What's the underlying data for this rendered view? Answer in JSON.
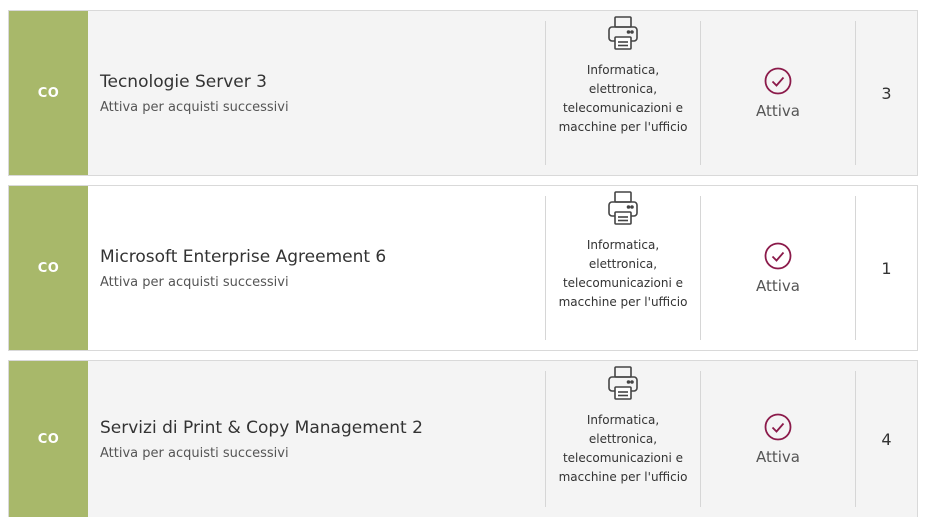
{
  "colors": {
    "type_strip": "#a8b86a",
    "status_icon": "#8b1a4a"
  },
  "rows": [
    {
      "type": "CO",
      "title": "Tecnologie Server 3",
      "subtitle": "Attiva per acquisti successivi",
      "category_icon": "printer-icon",
      "category": "Informatica, elettronica, telecomunicazioni e macchine per l'ufficio",
      "status_icon": "check-circle-icon",
      "status": "Attiva",
      "count": "3"
    },
    {
      "type": "CO",
      "title": "Microsoft Enterprise Agreement 6",
      "subtitle": "Attiva per acquisti successivi",
      "category_icon": "printer-icon",
      "category": "Informatica, elettronica, telecomunicazioni e macchine per l'ufficio",
      "status_icon": "check-circle-icon",
      "status": "Attiva",
      "count": "1"
    },
    {
      "type": "CO",
      "title": "Servizi di Print & Copy Management 2",
      "subtitle": "Attiva per acquisti successivi",
      "category_icon": "printer-icon",
      "category": "Informatica, elettronica, telecomunicazioni e macchine per l'ufficio",
      "status_icon": "check-circle-icon",
      "status": "Attiva",
      "count": "4"
    }
  ]
}
